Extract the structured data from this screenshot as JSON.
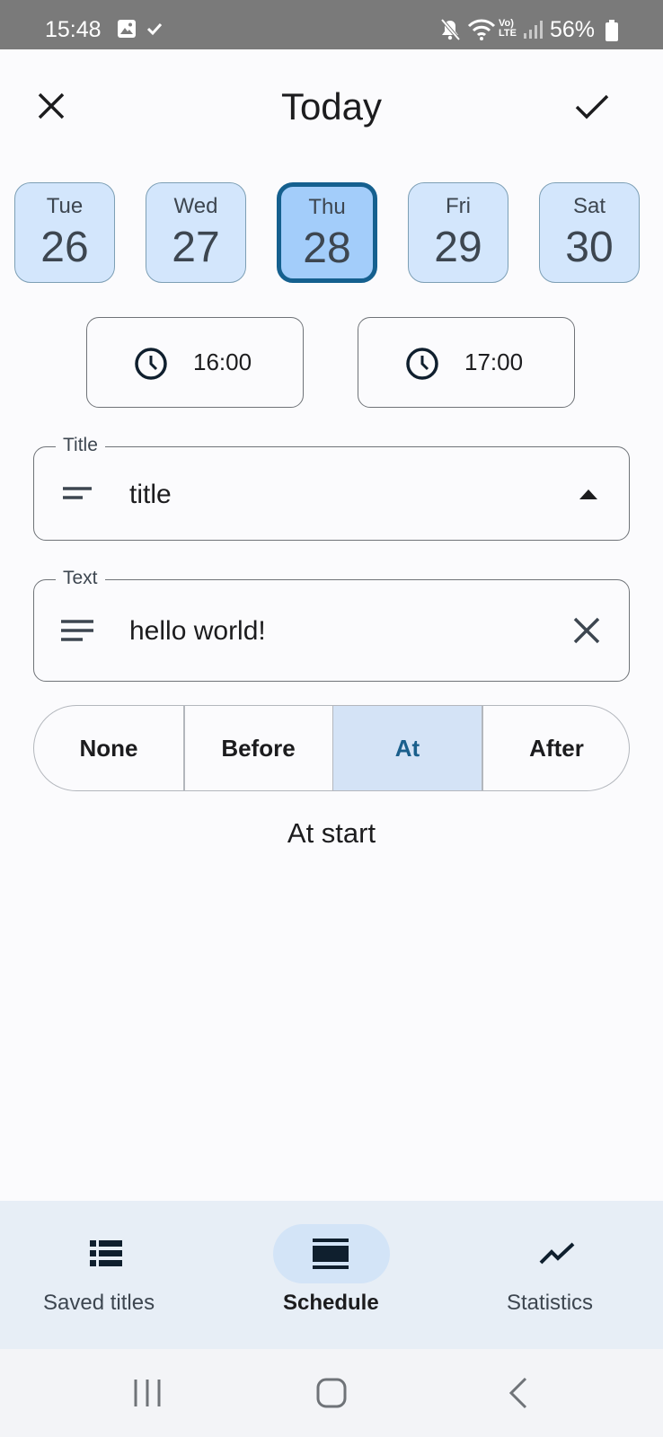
{
  "status_bar": {
    "time": "15:48",
    "battery": "56%",
    "icons": [
      "gallery-icon",
      "check-icon",
      "mute-icon",
      "wifi-icon",
      "volte-icon",
      "signal-icon",
      "battery-icon"
    ]
  },
  "top_bar": {
    "title": "Today",
    "close_icon": "close-icon",
    "confirm_icon": "check-icon"
  },
  "days": [
    {
      "dow": "Tue",
      "num": "26",
      "selected": false
    },
    {
      "dow": "Wed",
      "num": "27",
      "selected": false
    },
    {
      "dow": "Thu",
      "num": "28",
      "selected": true
    },
    {
      "dow": "Fri",
      "num": "29",
      "selected": false
    },
    {
      "dow": "Sat",
      "num": "30",
      "selected": false
    }
  ],
  "times": {
    "start": "16:00",
    "end": "17:00"
  },
  "title_field": {
    "label": "Title",
    "value": "title",
    "lead_icon": "short-text-icon",
    "trail_icon": "arrow-drop-up-icon"
  },
  "text_field": {
    "label": "Text",
    "value": "hello world!",
    "lead_icon": "notes-icon",
    "trail_icon": "clear-icon"
  },
  "reminder": {
    "options": [
      "None",
      "Before",
      "At",
      "After"
    ],
    "selected": "At",
    "caption": "At start"
  },
  "bottom_nav": {
    "items": [
      {
        "label": "Saved titles",
        "icon": "list-icon",
        "active": false
      },
      {
        "label": "Schedule",
        "icon": "view-agenda-icon",
        "active": true
      },
      {
        "label": "Statistics",
        "icon": "trending-icon",
        "active": false
      }
    ]
  },
  "colors": {
    "accent": "#15608f",
    "day_bg": "#d3e6fc",
    "day_selected_bg": "#a3cdfa",
    "segment_selected_bg": "#d4e3f6",
    "nav_bg": "#e7eef6"
  }
}
